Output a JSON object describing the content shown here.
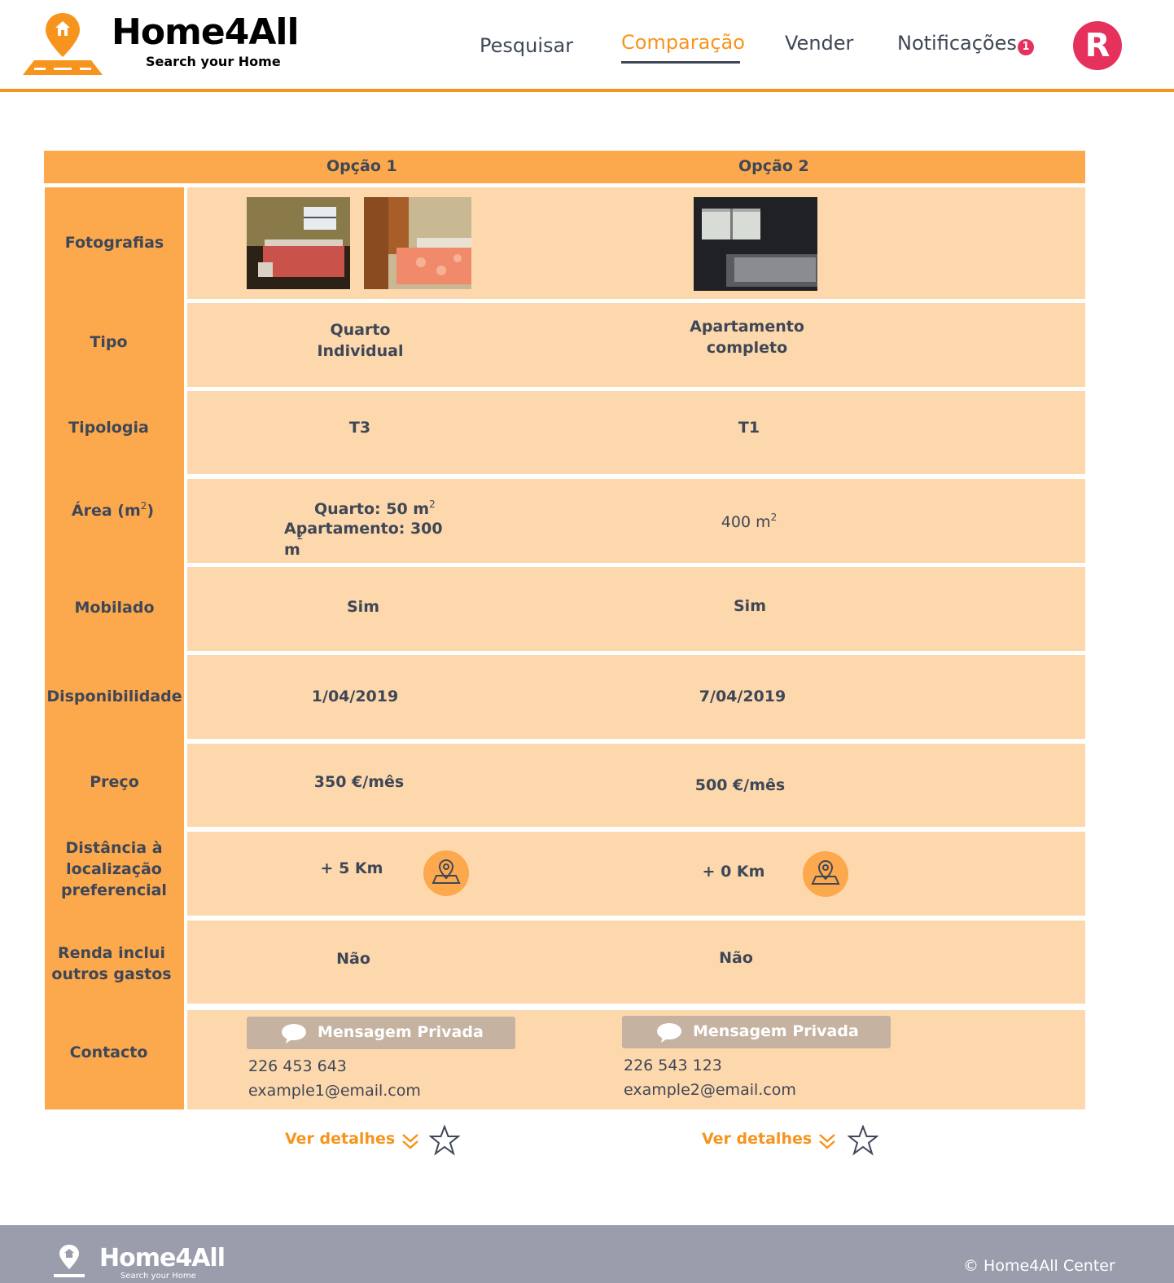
{
  "brand": {
    "title": "Home4All",
    "subtitle": "Search your Home",
    "accent": "#f7941d",
    "panel_color": "#fca84d",
    "cell_color": "#fdd8ad",
    "badge_color": "#e5315c"
  },
  "nav": {
    "search": "Pesquisar",
    "compare": "Comparação",
    "sell": "Vender",
    "notifications": "Notificações",
    "notifications_count": "1",
    "avatar_letter": "R"
  },
  "table": {
    "options": [
      "Opção 1",
      "Opção 2"
    ],
    "labels": {
      "photos": "Fotografias",
      "type": "Tipo",
      "typology": "Tipologia",
      "area": "Área (m",
      "area_sup": "2",
      "area_close": ")",
      "furnished": "Mobilado",
      "availability": "Disponibilidade",
      "price": "Preço",
      "distance": "Distância à localização preferencial",
      "rent_includes": "Renda inclui outros gastos",
      "contact": "Contacto"
    },
    "option1": {
      "type": "Quarto Individual",
      "typology": "T3",
      "area_room": "Quarto: 50 m",
      "area_apartment": "Apartamento: 300 m",
      "area_sup": "2",
      "furnished": "Sim",
      "availability": "1/04/2019",
      "price": "350 €/mês",
      "distance": "+ 5 Km",
      "rent_includes": "Não",
      "message_button": "Mensagem Privada",
      "phone": "226 453 643",
      "email": "example1@email.com",
      "details": "Ver detalhes"
    },
    "option2": {
      "type": "Apartamento completo",
      "typology": "T1",
      "area": "400 m",
      "area_sup": "2",
      "furnished": "Sim",
      "availability": "7/04/2019",
      "price": "500 €/mês",
      "distance": "+ 0 Km",
      "rent_includes": "Não",
      "message_button": "Mensagem Privada",
      "phone": "226 543 123",
      "email": "example2@email.com",
      "details": "Ver detalhes"
    }
  },
  "footer": {
    "title": "Home4All",
    "subtitle": "Search your Home",
    "copyright": "© Home4All Center"
  }
}
